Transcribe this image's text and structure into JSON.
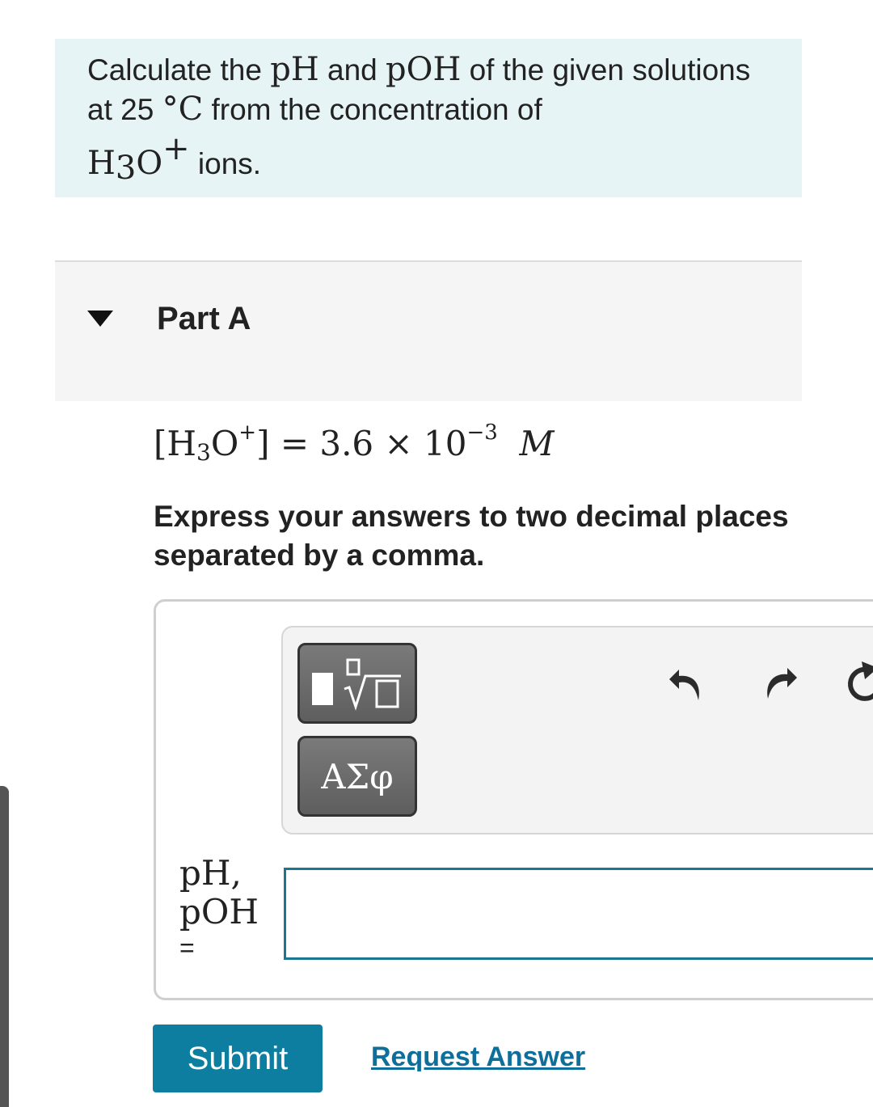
{
  "intro": {
    "text_1": "Calculate the ",
    "ph": "pH",
    "text_2": " and ",
    "poh": "pOH",
    "text_3": " of the given solutions at 25 ",
    "degree": "°C",
    "text_4": " from the concentration of ",
    "h": "H",
    "sub3": "3",
    "o": "O",
    "plus": "+",
    "text_5": " ions."
  },
  "part": {
    "title": "Part A"
  },
  "equation": {
    "open": "[H",
    "sub3": "3",
    "o": "O",
    "plus": "+",
    "close": "]",
    "equals": " = 3.6 × 10",
    "exp": "−3",
    "unit": "M"
  },
  "instructions": "Express your answers to two decimal places separated by a comma.",
  "toolbar": {
    "greek_label": "ΑΣφ",
    "templates_icon": "templates-radical-icon",
    "undo_icon": "undo-icon",
    "redo_icon": "redo-icon",
    "reset_icon": "reset-icon"
  },
  "answer": {
    "label_line1": "pH,",
    "label_line2": "pOH",
    "label_eq": "=",
    "value": ""
  },
  "buttons": {
    "submit": "Submit",
    "request_answer": "Request Answer"
  },
  "colors": {
    "intro_bg": "#e6f4f5",
    "accent": "#0e7ea0",
    "link": "#0e6f9a",
    "input_border": "#1d7690"
  }
}
